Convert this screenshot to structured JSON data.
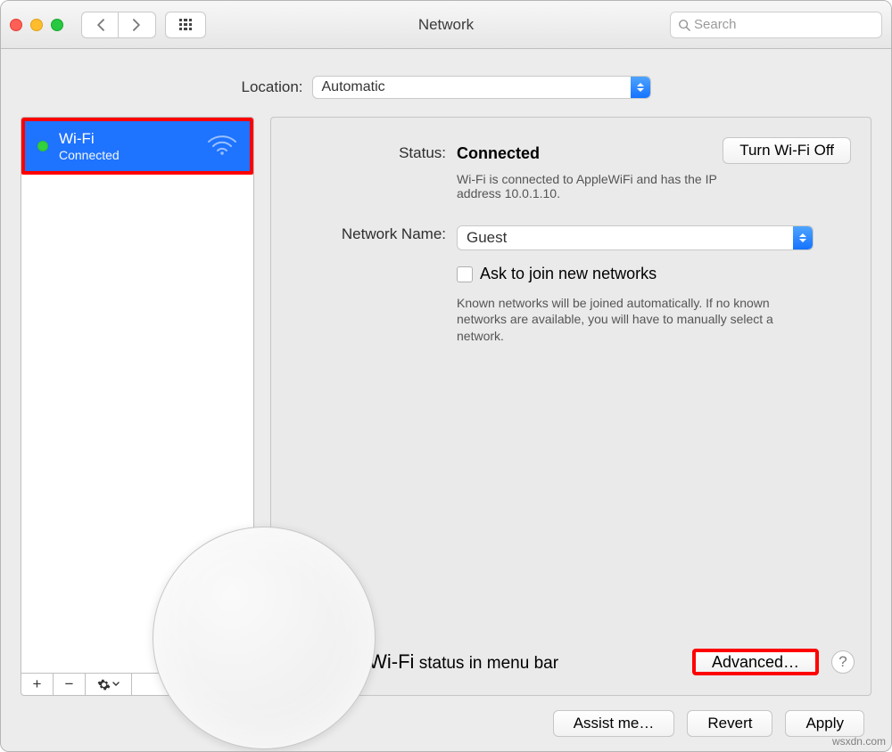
{
  "window": {
    "title": "Network"
  },
  "toolbar": {
    "search_placeholder": "Search"
  },
  "location": {
    "label": "Location:",
    "value": "Automatic"
  },
  "sidebar": {
    "items": [
      {
        "name": "Wi-Fi",
        "status": "Connected"
      }
    ],
    "add_label": "+",
    "remove_label": "−"
  },
  "detail": {
    "status_label": "Status:",
    "status_value": "Connected",
    "status_desc": "Wi-Fi is connected to AppleWiFi and has the IP address 10.0.1.10.",
    "turn_off_label": "Turn Wi-Fi Off",
    "network_name_label": "Network Name:",
    "network_name_value": "Guest",
    "ask_join_label": "Ask to join new networks",
    "ask_join_hint": "Known networks will be joined automatically. If no known networks are available, you will have to manually select a network.",
    "show_menubar_prefix": "Show Wi-Fi",
    "show_menubar_suffix": " status in menu bar",
    "advanced_label": "Advanced…",
    "help_label": "?"
  },
  "footer": {
    "assist_label": "Assist me…",
    "revert_label": "Revert",
    "apply_label": "Apply"
  },
  "watermark": "wsxdn.com"
}
